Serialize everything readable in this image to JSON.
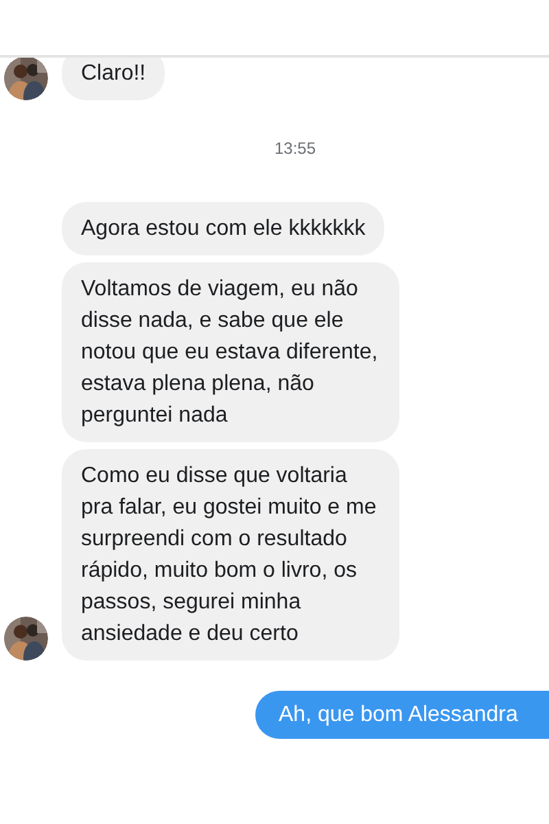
{
  "messages": [
    {
      "kind": "incoming",
      "text": "Claro!!",
      "avatar": true
    },
    {
      "kind": "timestamp",
      "text": "13:55"
    },
    {
      "kind": "incoming",
      "text": "Agora estou com ele kkkkkkk",
      "avatar": false
    },
    {
      "kind": "incoming",
      "text": "Voltamos de viagem, eu não disse nada, e sabe que ele notou que eu estava diferente, estava plena plena, não perguntei nada",
      "avatar": false
    },
    {
      "kind": "incoming",
      "text": "Como eu disse que voltaria pra falar, eu gostei muito e me surpreendi com o resultado rápido, muito bom o livro, os passos, segurei minha ansiedade e deu certo",
      "avatar": true
    },
    {
      "kind": "outgoing",
      "text": "Ah, que bom Alessandra"
    }
  ]
}
